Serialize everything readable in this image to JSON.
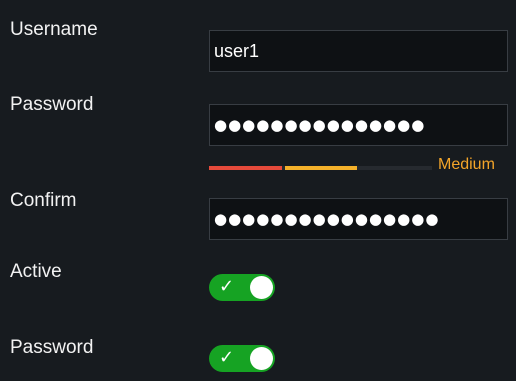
{
  "form": {
    "username_label": "Username",
    "username_value": "user1",
    "password_label": "Password",
    "password_mask": "●●●●●●●●●●●●●●●",
    "strength_label": "Medium",
    "confirm_label": "Confirm",
    "confirm_mask": "●●●●●●●●●●●●●●●●",
    "active_label": "Active",
    "active_enabled": true,
    "password_toggle_label": "Password",
    "password_toggle_enabled": true
  },
  "colors": {
    "background": "#171b1f",
    "input_background": "#0e1114",
    "strength_weak": "#e64a3b",
    "strength_medium": "#f4b12a",
    "strength_text": "#f4a529",
    "toggle_on": "#16a323"
  },
  "icons": {
    "toggle_check": "check-icon"
  }
}
